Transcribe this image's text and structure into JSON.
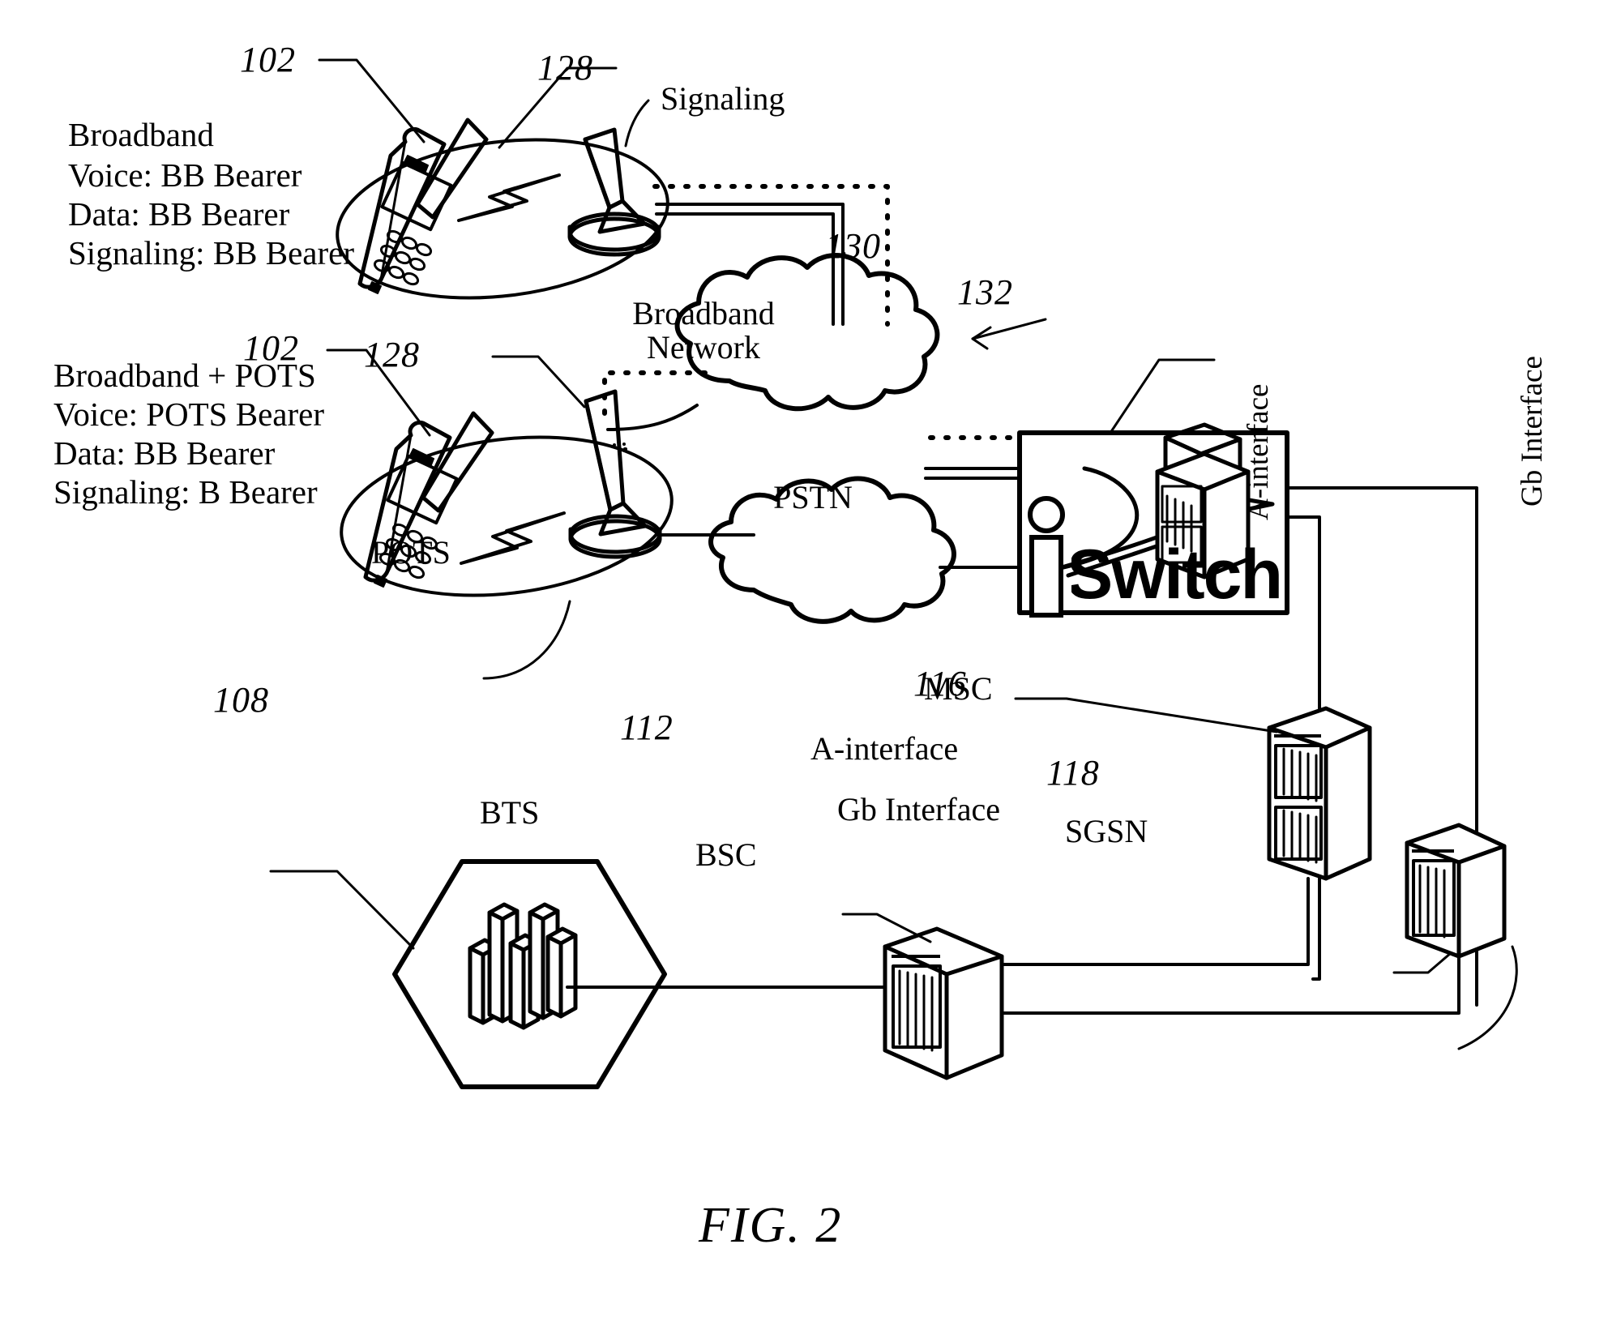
{
  "figure": {
    "caption": "FIG. 2"
  },
  "reference_numerals": {
    "phone_top": "102",
    "tower_top": "128",
    "phone_bottom": "102",
    "tower_bottom": "128",
    "broadband_network": "130",
    "iswitch": "132",
    "bts_cell": "108",
    "bsc": "112",
    "msc": "116",
    "sgsn": "118"
  },
  "bearer_blocks": [
    {
      "title": "Broadband",
      "lines": [
        "Voice:  BB Bearer",
        "Data:   BB Bearer",
        "Signaling: BB Bearer"
      ]
    },
    {
      "title": "Broadband + POTS",
      "lines": [
        "Voice:  POTS Bearer",
        "Data:  BB Bearer",
        "Signaling: B Bearer"
      ]
    }
  ],
  "clouds": [
    {
      "name": "broadband-network-cloud",
      "line1": "Broadband",
      "line2": "Network"
    },
    {
      "name": "pstn-cloud",
      "line1": "PSTN",
      "line2": ""
    }
  ],
  "nodes": {
    "iswitch_label": "iSwitch",
    "msc_label": "MSC",
    "sgsn_label": "SGSN",
    "bts_label": "BTS",
    "bsc_label": "BSC"
  },
  "connection_labels": {
    "signaling": "Signaling",
    "pots": "POTS",
    "a_interface_vertical": "A-interface",
    "gb_interface_vertical": "Gb Interface",
    "a_interface_horizontal": "A-interface",
    "gb_interface_horizontal": "Gb Interface"
  },
  "colors": {
    "ink": "#000000",
    "paper": "#ffffff"
  }
}
